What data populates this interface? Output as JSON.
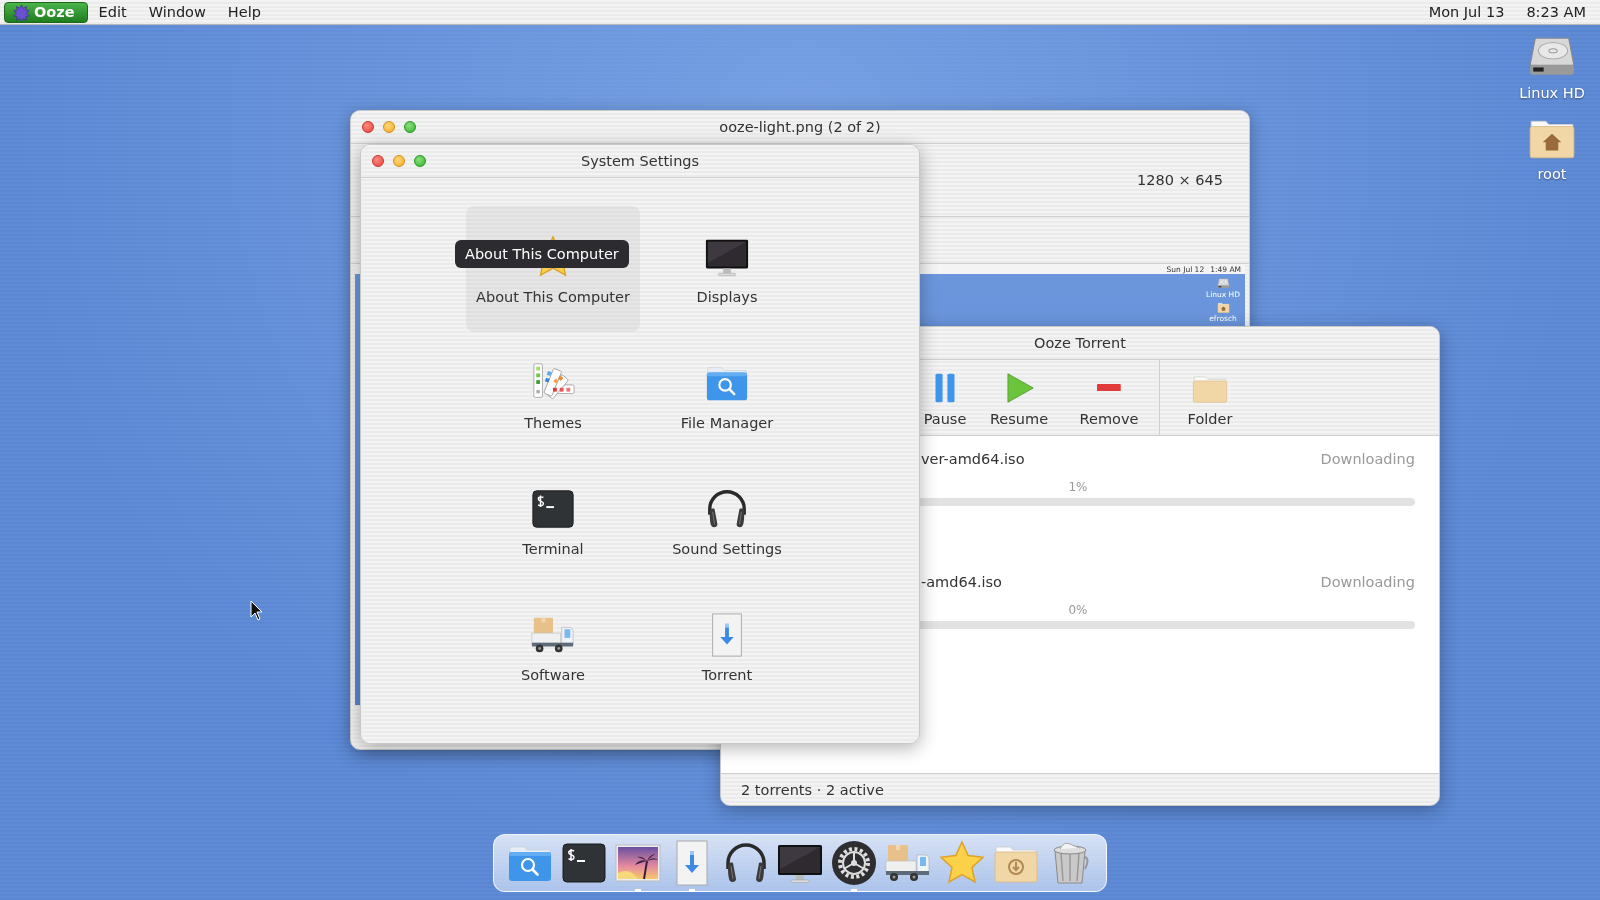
{
  "menubar": {
    "app": "Ooze",
    "menus": [
      "Edit",
      "Window",
      "Help"
    ],
    "date": "Mon Jul 13",
    "time": "8:23 AM"
  },
  "desktop_icons": [
    {
      "label": "Linux HD",
      "kind": "drive"
    },
    {
      "label": "root",
      "kind": "home"
    }
  ],
  "viewer": {
    "title": "ooze-light.png (2 of 2)",
    "dimensions": "1280 × 645",
    "screenshot": {
      "date": "Sun Jul 12",
      "time": "1:49 AM",
      "icons": [
        {
          "label": "Linux HD",
          "kind": "drive"
        },
        {
          "label": "efrosch",
          "kind": "home"
        }
      ]
    }
  },
  "torrent": {
    "title": "Ooze Torrent",
    "toolbar": [
      [
        {
          "label": "Pause",
          "kind": "pause"
        },
        {
          "label": "Resume",
          "kind": "resume"
        },
        {
          "label": "Remove",
          "kind": "remove"
        }
      ],
      [
        {
          "label": "Folder",
          "kind": "folder"
        }
      ]
    ],
    "torrents": [
      {
        "name": "ver-amd64.iso",
        "status": "Downloading",
        "progress": "1%"
      },
      {
        "name": "-amd64.iso",
        "status": "Downloading",
        "progress": "0%"
      }
    ],
    "status": "2 torrents · 2 active"
  },
  "settings": {
    "title": "System Settings",
    "tooltip": "About This Computer",
    "tiles": [
      {
        "label": "About This Computer",
        "kind": "about",
        "selected": true
      },
      {
        "label": "Displays",
        "kind": "displays",
        "selected": false
      },
      {
        "label": "Themes",
        "kind": "themes",
        "selected": false
      },
      {
        "label": "File Manager",
        "kind": "file-manager",
        "selected": false
      },
      {
        "label": "Terminal",
        "kind": "terminal",
        "selected": false
      },
      {
        "label": "Sound Settings",
        "kind": "sound",
        "selected": false
      },
      {
        "label": "Software",
        "kind": "software",
        "selected": false
      },
      {
        "label": "Torrent",
        "kind": "torrent",
        "selected": false
      }
    ]
  },
  "dock": [
    {
      "kind": "file-manager",
      "running": false
    },
    {
      "kind": "terminal",
      "running": false
    },
    {
      "kind": "photos",
      "running": true
    },
    {
      "kind": "torrent",
      "running": true
    },
    {
      "kind": "sound",
      "running": false
    },
    {
      "kind": "displays",
      "running": false
    },
    {
      "kind": "settings",
      "running": true
    },
    {
      "kind": "software",
      "running": false
    },
    {
      "kind": "about",
      "running": false
    },
    {
      "kind": "downloads",
      "running": false
    },
    {
      "kind": "trash",
      "running": false
    }
  ]
}
